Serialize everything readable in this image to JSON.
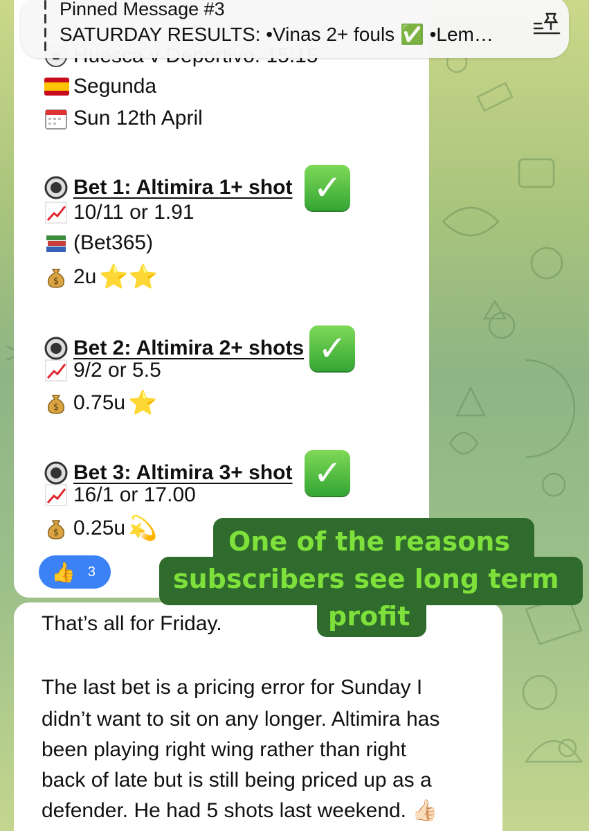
{
  "pinned": {
    "title": "Pinned Message #3",
    "text": "SATURDAY RESULTS: •Vinas 2+ fouls ✅ •Lem…"
  },
  "message1": {
    "match_line": "Huesca v Deportivo: 15:15",
    "league": "Segunda",
    "date": "Sun 12th April",
    "bets": [
      {
        "title": "Bet 1: Altimira 1+ shot",
        "odds": "10/11 or 1.91",
        "bookmaker": "(Bet365)",
        "stake": "2u",
        "stars": "⭐⭐"
      },
      {
        "title": "Bet 2: Altimira 2+ shots",
        "odds": "9/2 or 5.5",
        "stake": "0.75u",
        "stars": "⭐"
      },
      {
        "title": "Bet 3: Altimira 3+ shot",
        "odds": "16/1 or 17.00",
        "stake": "0.25u",
        "stars": "💫"
      }
    ],
    "reaction": {
      "emoji": "👍",
      "count": "3"
    }
  },
  "callout": {
    "line1": "One of the reasons",
    "line2": "subscribers see long term",
    "line3": "profit"
  },
  "message2": {
    "p1": "That’s all for Friday.",
    "p2_lines": [
      "The last bet is a pricing error for Sunday I",
      "didn’t want to sit on any longer. Altimira has",
      "been playing right wing rather than right",
      "back of late but is still being priced up as a",
      "defender. He had 5 shots last weekend. 👍🏻"
    ]
  },
  "colors": {
    "callout_bg": "#2e6b2c",
    "callout_text": "#7ee03a",
    "check_green": "#34a634",
    "reaction_blue": "#3b82f6"
  }
}
